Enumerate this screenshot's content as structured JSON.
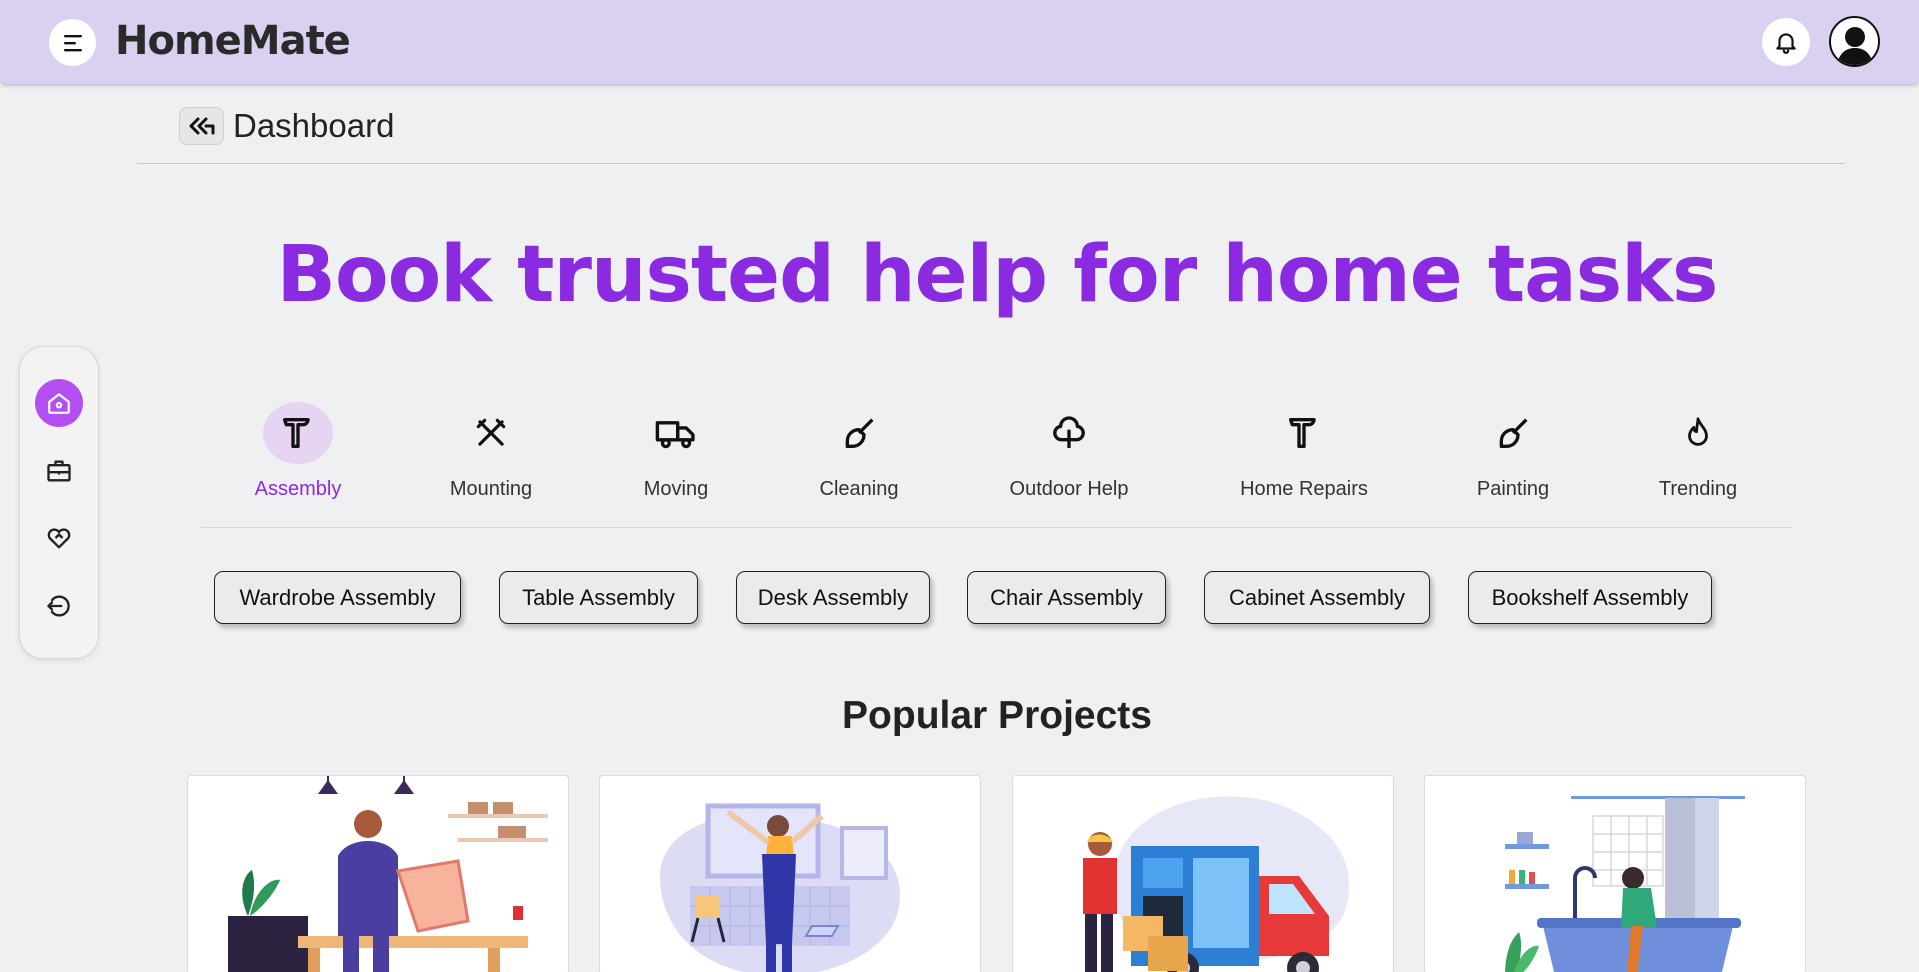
{
  "header": {
    "logo": "HomeMate",
    "icons": [
      "menu-icon",
      "bell-icon",
      "user-avatar-icon"
    ]
  },
  "breadcrumb": {
    "title": "Dashboard",
    "back_icon": "double-chevron-left-icon"
  },
  "hero": {
    "headline": "Book trusted help for home tasks"
  },
  "sidenav": {
    "items": [
      {
        "icon": "home-icon",
        "active": true
      },
      {
        "icon": "briefcase-icon",
        "active": false
      },
      {
        "icon": "heart-handshake-icon",
        "active": false
      },
      {
        "icon": "logout-icon",
        "active": false
      }
    ]
  },
  "categories": [
    {
      "label": "Assembly",
      "icon": "hammer-icon",
      "active": true
    },
    {
      "label": "Mounting",
      "icon": "tools-icon",
      "active": false
    },
    {
      "label": "Moving",
      "icon": "truck-icon",
      "active": false
    },
    {
      "label": "Cleaning",
      "icon": "brush-icon",
      "active": false
    },
    {
      "label": "Outdoor Help",
      "icon": "tree-icon",
      "active": false
    },
    {
      "label": "Home Repairs",
      "icon": "hammer-icon",
      "active": false
    },
    {
      "label": "Painting",
      "icon": "brush-icon",
      "active": false
    },
    {
      "label": "Trending",
      "icon": "flame-icon",
      "active": false
    }
  ],
  "chips": [
    "Wardrobe Assembly",
    "Table Assembly",
    "Desk Assembly",
    "Chair Assembly",
    "Cabinet Assembly",
    "Bookshelf Assembly"
  ],
  "popular": {
    "title": "Popular Projects",
    "cards": [
      {
        "illustration": "furniture-assembly-illustration"
      },
      {
        "illustration": "wall-mounting-illustration"
      },
      {
        "illustration": "moving-truck-illustration"
      },
      {
        "illustration": "cleaning-illustration"
      }
    ]
  },
  "colors": {
    "accent": "#8a2be2",
    "header_bg": "#dbd0ef",
    "active_nav": "#b34ff0"
  }
}
